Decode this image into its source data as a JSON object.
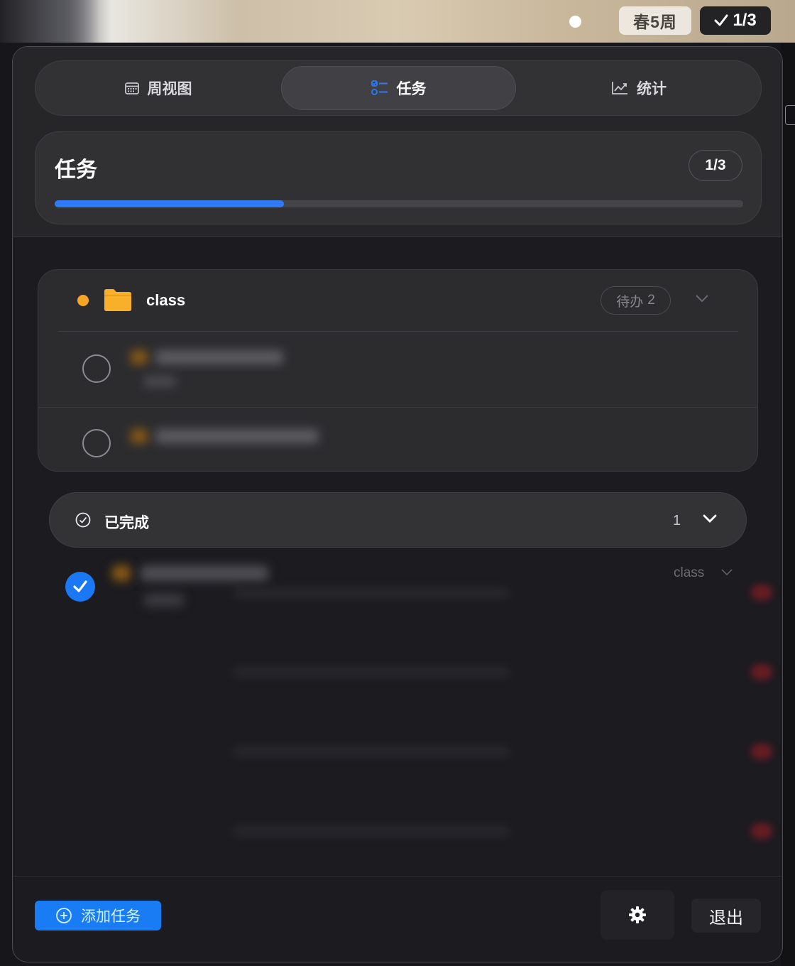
{
  "menubar": {
    "week_label": "春5周",
    "progress_label": "1/3"
  },
  "tabs": [
    {
      "label": "周视图",
      "icon": "calendar-icon",
      "active": false
    },
    {
      "label": "任务",
      "icon": "task-list-icon",
      "active": true
    },
    {
      "label": "统计",
      "icon": "chart-icon",
      "active": false
    }
  ],
  "header": {
    "title": "任务",
    "count": "1/3",
    "progress_fraction": 0.333
  },
  "group": {
    "name": "class",
    "pending_label": "待办",
    "pending_count": "2",
    "dot_color": "#f8a525",
    "folder_color": "#f8b02a"
  },
  "completed": {
    "label": "已完成",
    "count": "1",
    "item_tag": "class"
  },
  "footer": {
    "add_label": "添加任务",
    "exit_label": "退出"
  },
  "colors": {
    "accent": "#1a7cf5",
    "panel": "#1b1b20"
  }
}
